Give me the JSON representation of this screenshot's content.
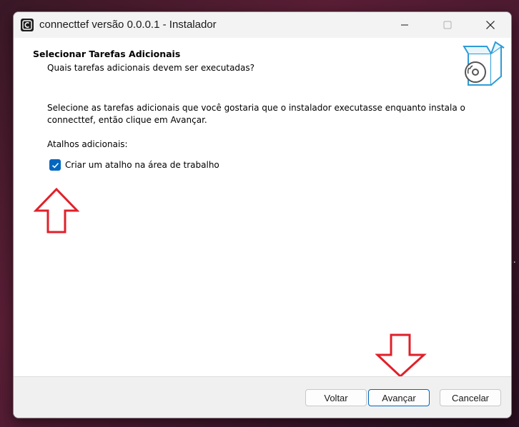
{
  "window": {
    "title": "connecttef versão 0.0.0.1 - Instalador",
    "app_icon": "installer-app-icon",
    "controls": {
      "minimize_icon": "minimize-icon",
      "maximize_icon": "maximize-icon",
      "close_icon": "close-icon"
    }
  },
  "header": {
    "title": "Selecionar Tarefas Adicionais",
    "subtitle": "Quais tarefas adicionais devem ser executadas?",
    "icon": "installer-box-icon"
  },
  "content": {
    "description": "Selecione as tarefas adicionais que você gostaria que o instalador executasse enquanto instala o connecttef, então clique em Avançar.",
    "group_label": "Atalhos adicionais:",
    "tasks": [
      {
        "label": "Criar um atalho na área de trabalho",
        "checked": true
      }
    ]
  },
  "annotations": {
    "arrow_color": "#e0202a"
  },
  "buttons": {
    "back": "Voltar",
    "next": "Avançar",
    "cancel": "Cancelar"
  },
  "colors": {
    "accent": "#0067c0",
    "footer_bg": "#f0f0f0"
  },
  "desktop": {
    "edge_text": "9.."
  }
}
